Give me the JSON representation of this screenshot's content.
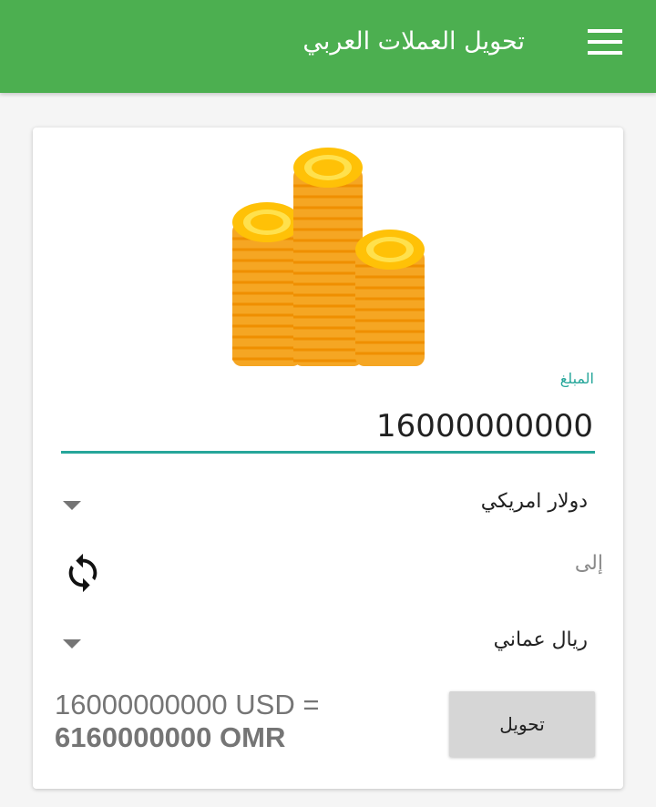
{
  "appbar": {
    "title": "تحويل العملات العربي",
    "menu_icon": "hamburger-menu-icon",
    "color": "#4caf50"
  },
  "card": {
    "image": "gold-coins-stack",
    "amount": {
      "label": "المبلغ",
      "value": "16000000000",
      "accent_color": "#26a69a"
    },
    "from_currency": {
      "selected": "دولار امريكي"
    },
    "to_label": "إلى",
    "swap_icon": "swap-refresh-icon",
    "to_currency": {
      "selected": "ريال عماني"
    },
    "result": {
      "line1": "16000000000 USD =",
      "line2": "6160000000 OMR"
    },
    "convert_button": "تحويل"
  }
}
